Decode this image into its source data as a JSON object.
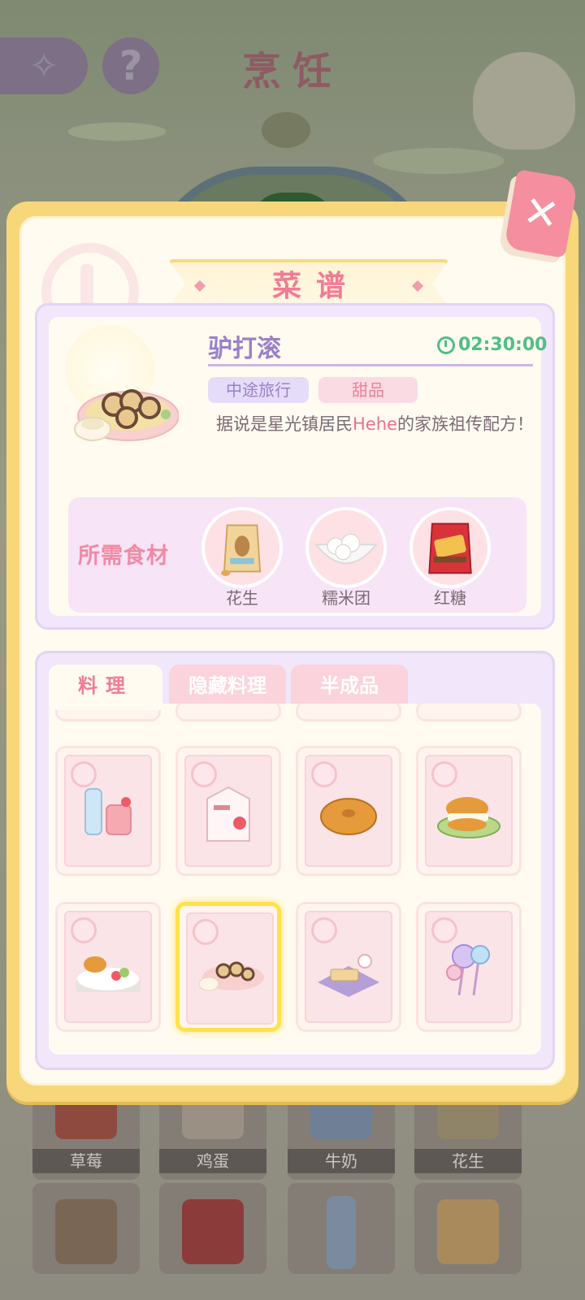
{
  "background": {
    "page_title": "烹饪",
    "inventory": [
      {
        "label": "草莓"
      },
      {
        "label": "鸡蛋"
      },
      {
        "label": "牛奶"
      },
      {
        "label": "花生"
      },
      {
        "label": ""
      },
      {
        "label": ""
      },
      {
        "label": ""
      },
      {
        "label": ""
      }
    ]
  },
  "modal": {
    "title": "菜谱",
    "recipe": {
      "name": "驴打滚",
      "timer": "02:30:00",
      "tags": [
        "中途旅行",
        "甜品"
      ],
      "description_before": "据说是星光镇居民",
      "description_highlight": "Hehe",
      "description_after": "的家族祖传配方！",
      "ingredients_title": "所需食材",
      "ingredients": [
        {
          "label": "花生",
          "icon": "peanut-bag-icon"
        },
        {
          "label": "糯米团",
          "icon": "rice-ball-bowl-icon"
        },
        {
          "label": "红糖",
          "icon": "brown-sugar-bag-icon"
        }
      ]
    },
    "tabs": [
      "料理",
      "隐藏料理",
      "半成品"
    ],
    "active_tab": "料理",
    "grid_items": [
      {
        "icon": "water-and-juice-icon"
      },
      {
        "icon": "strawberry-milk-carton-icon"
      },
      {
        "icon": "bagel-icon"
      },
      {
        "icon": "cream-burger-icon"
      },
      {
        "icon": "breakfast-platter-icon"
      },
      {
        "icon": "rolled-pastry-dish-icon",
        "selected": true
      },
      {
        "icon": "sandwich-and-tea-icon"
      },
      {
        "icon": "lollipop-icon"
      }
    ]
  },
  "colors": {
    "accent_pink": "#f07d94",
    "lavender": "#9b80c9",
    "timer_green": "#4fbf86",
    "modal_border": "#f7d77a"
  }
}
